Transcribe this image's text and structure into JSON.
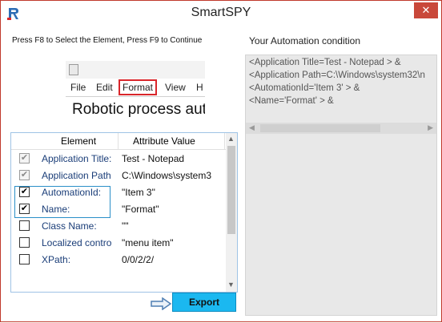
{
  "window": {
    "title": "SmartSPY",
    "close_glyph": "✕",
    "logo_icon": "smartspy-logo-icon"
  },
  "left": {
    "instruction": "Press F8 to Select the Element, Press F9 to Continue",
    "preview": {
      "menu": [
        "File",
        "Edit",
        "Format",
        "View",
        "H"
      ],
      "highlighted_menu": "Format",
      "document_text": "Robotic process aut",
      "highlight_color": "#d9262b"
    },
    "table": {
      "headers": [
        "Element",
        "Attribute Value"
      ],
      "rows": [
        {
          "checked": true,
          "disabled": true,
          "element": "Application Title:",
          "value": "Test - Notepad"
        },
        {
          "checked": true,
          "disabled": true,
          "element": "Application Path",
          "value": "C:\\Windows\\system3"
        },
        {
          "checked": true,
          "disabled": false,
          "element": "AutomationId:",
          "value": "\"Item 3\""
        },
        {
          "checked": true,
          "disabled": false,
          "element": "Name:",
          "value": "\"Format\""
        },
        {
          "checked": false,
          "disabled": false,
          "element": "Class Name:",
          "value": "\"\""
        },
        {
          "checked": false,
          "disabled": false,
          "element": "Localized contro",
          "value": "\"menu item\""
        },
        {
          "checked": false,
          "disabled": false,
          "element": "XPath:",
          "value": "0/0/2/2/"
        }
      ]
    },
    "export_label": "Export",
    "export_color": "#1bb8f0"
  },
  "right": {
    "title": "Your Automation condition",
    "lines": [
      "<Application Title=Test - Notepad > &",
      "<Application Path=C:\\Windows\\system32\\n",
      "<AutomationId='Item 3' > &",
      "<Name='Format' > &"
    ]
  }
}
